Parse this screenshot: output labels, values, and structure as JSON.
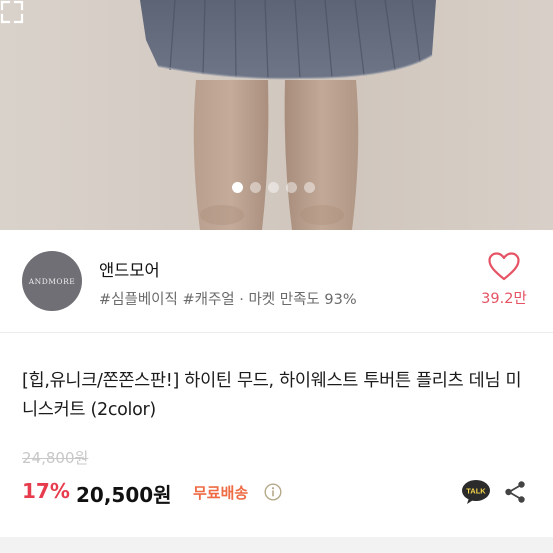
{
  "carousel": {
    "total": 5,
    "active": 0
  },
  "seller": {
    "logo_text": "ANDMORE",
    "name": "앤드모어",
    "tags": "#심플베이직 #캐주얼 · 마켓 만족도 93%",
    "like_count": "39.2만"
  },
  "product": {
    "title": "[힙,유니크/쫀쫀스판!] 하이틴 무드, 하이웨스트 투버튼 플리츠 데님 미니스커트 (2color)",
    "original_price": "24,800원",
    "discount": "17%",
    "price": "20,500원",
    "shipping": "무료배송",
    "talk_label": "TALK"
  },
  "colors": {
    "accent_red": "#e63c4d",
    "shipping_orange": "#ee6b44",
    "heart_pink": "#e55364"
  },
  "icons": [
    "expand-icon",
    "heart-icon",
    "info-icon",
    "talk-icon",
    "share-icon"
  ]
}
